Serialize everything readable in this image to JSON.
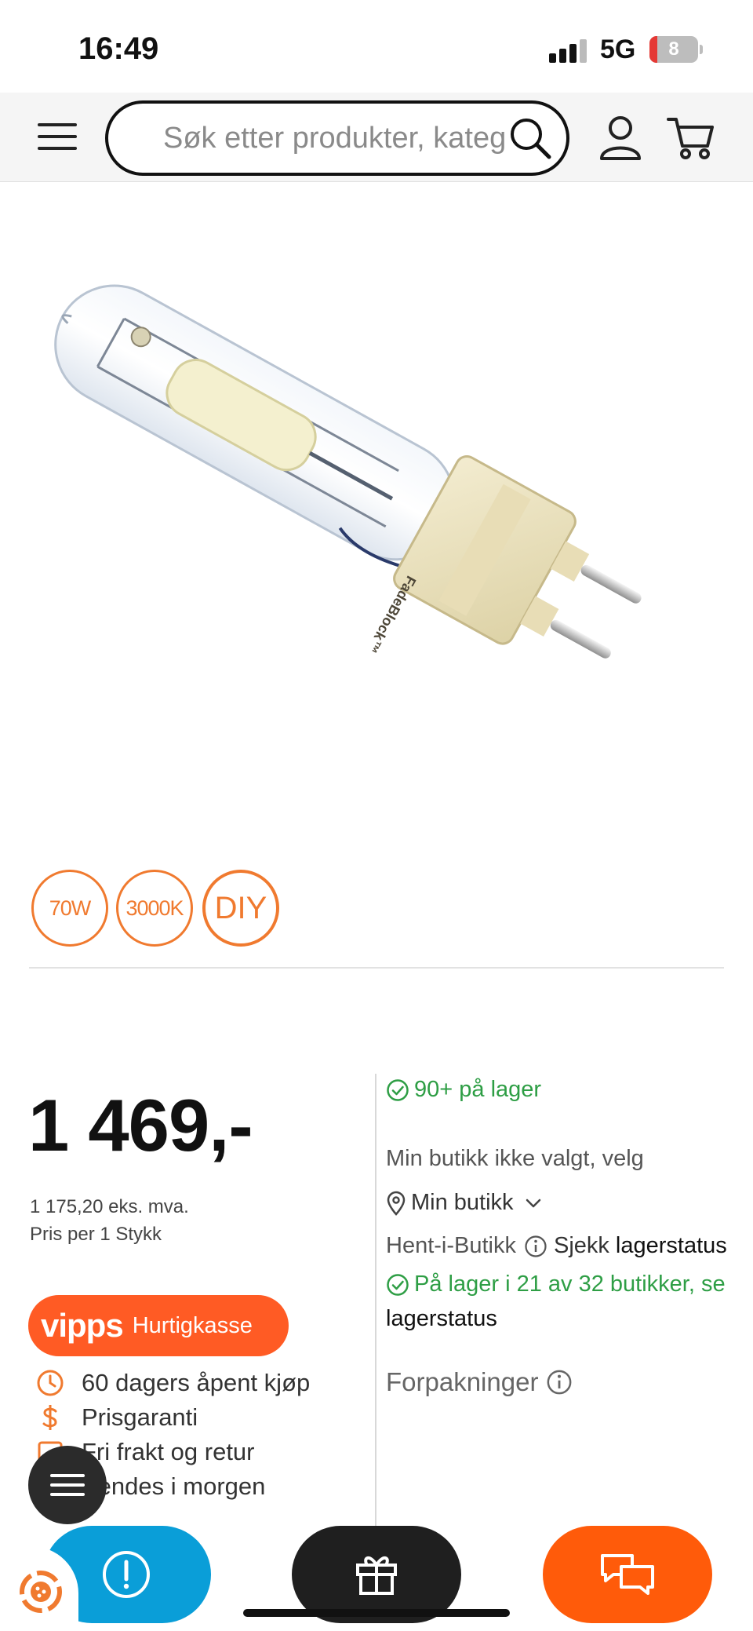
{
  "status_bar": {
    "time": "16:49",
    "network": "5G",
    "battery": "8"
  },
  "header": {
    "search_placeholder": "Søk etter produkter, kateg"
  },
  "product": {
    "image_alt": "Metal halide lamp FadeBlock 70W"
  },
  "badges": [
    "70W",
    "3000K",
    "DIY"
  ],
  "price": {
    "main": "1 469,-",
    "ex_vat": "1 175,20 eks. mva.",
    "per_unit": "Pris per 1 Stykk"
  },
  "vipps": {
    "logo": "vipps",
    "label": "Hurtigkasse"
  },
  "usps": [
    {
      "icon": "clock-icon",
      "text": "60 dagers åpent kjøp"
    },
    {
      "icon": "dollar-icon",
      "text": "Prisgaranti"
    },
    {
      "icon": "box-icon",
      "text": "Fri frakt og retur"
    },
    {
      "icon": "truck-icon",
      "text": "Sendes i morgen"
    }
  ],
  "stock": {
    "online": "90+ på lager",
    "store_not_selected": "Min butikk ikke valgt, velg",
    "my_store": "Min butikk",
    "pickup_label": "Hent-i-Butikk",
    "pickup_check": "Sjekk",
    "pickup_link": "lagerstatus",
    "stores_stock": "På lager i 21 av 32 butikker, se",
    "stores_stock_link": "lagerstatus"
  },
  "packaging": {
    "label": "Forpakninger"
  },
  "colors": {
    "accent_orange": "#ff5b0a",
    "stock_green": "#2e9e45",
    "help_blue": "#0a9ed8"
  }
}
